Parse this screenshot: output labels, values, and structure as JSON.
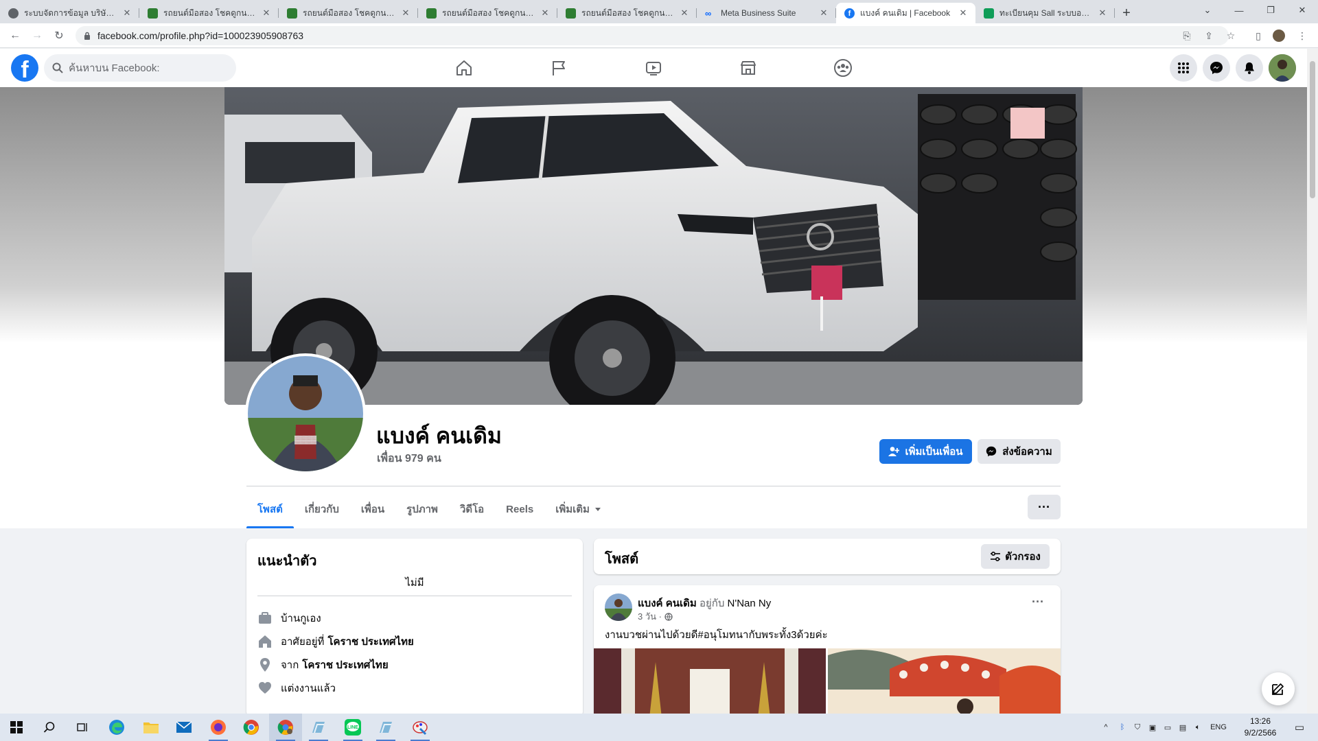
{
  "browser": {
    "tabs": [
      {
        "title": "ระบบจัดการข้อมูล บริษัท โชคดู",
        "favicon": "#5f6368",
        "active": false
      },
      {
        "title": "รถยนต์มือสอง โชคดูกนโยด อุดร",
        "favicon": "#2e7d32",
        "active": false
      },
      {
        "title": "รถยนต์มือสอง โชคดูกนโยด อุดร",
        "favicon": "#2e7d32",
        "active": false
      },
      {
        "title": "รถยนต์มือสอง โชคดูกนโยด อุดร",
        "favicon": "#2e7d32",
        "active": false
      },
      {
        "title": "รถยนต์มือสอง โชคดูกนโยด อุดร",
        "favicon": "#2e7d32",
        "active": false
      },
      {
        "title": "Meta Business Suite",
        "favicon": "#0866ff",
        "active": false
      },
      {
        "title": "แบงค์ คนเดิม | Facebook",
        "favicon": "#1877f2",
        "active": true
      },
      {
        "title": "ทะเบียนคุม Sall ระบบออนไลน์",
        "favicon": "#0f9d58",
        "active": false
      }
    ],
    "new_tab": "+",
    "url": "facebook.com/profile.php?id=100023905908763"
  },
  "fb": {
    "search_placeholder": "ค้นหาบน Facebook:",
    "logo_letter": "f",
    "profile": {
      "name": "แบงค์ คนเดิม",
      "friends": "เพื่อน 979 คน",
      "add_friend": "เพิ่มเป็นเพื่อน",
      "message": "ส่งข้อความ"
    },
    "tabs": [
      "โพสต์",
      "เกี่ยวกับ",
      "เพื่อน",
      "รูปภาพ",
      "วิดีโอ",
      "Reels",
      "เพิ่มเติม"
    ],
    "more_dots": "···",
    "intro": {
      "title": "แนะนำตัว",
      "bio": "ไม่มี",
      "rows": [
        {
          "icon": "briefcase-icon",
          "text": "บ้านกูเอง",
          "bold": ""
        },
        {
          "icon": "home-icon",
          "text": "อาศัยอยู่ที่",
          "bold": "โคราช ประเทศไทย"
        },
        {
          "icon": "location-pin-icon",
          "text": "จาก",
          "bold": "โคราช ประเทศไทย"
        },
        {
          "icon": "heart-icon",
          "text": "แต่งงานแล้ว",
          "bold": ""
        }
      ]
    },
    "posts": {
      "title": "โพสต์",
      "filter": "ตัวกรอง"
    },
    "post": {
      "author": "แบงค์ คนเดิม",
      "with_text": "อยู่กับ",
      "with_name": "N'Nan Ny",
      "time": "3 วัน ·",
      "text": "งานบวชผ่านไปด้วยดี#อนุโมทนากับพระทั้ง3ด้วยค่ะ",
      "dots": "···"
    }
  },
  "taskbar": {
    "lang": "ENG",
    "time": "13:26",
    "date": "9/2/2566"
  },
  "colors": {
    "fb_blue": "#1877f2",
    "button_blue": "#1b74e4",
    "secondary_button": "#e4e6eb",
    "page_bg": "#f0f2f5"
  }
}
